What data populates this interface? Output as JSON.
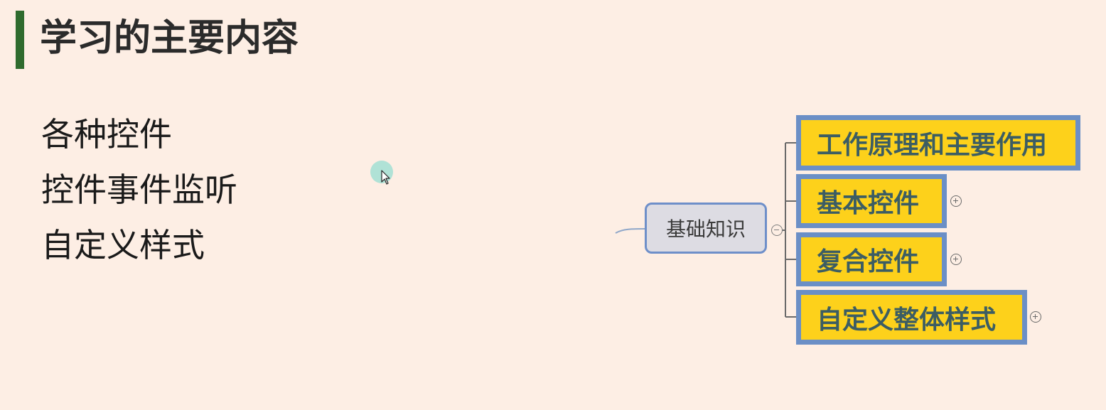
{
  "slide": {
    "title": "学习的主要内容",
    "bullets": [
      "各种控件",
      "控件事件监听",
      "自定义样式"
    ]
  },
  "mindmap": {
    "root": {
      "label": "基础知识",
      "toggle_icon": "collapse-minus-icon"
    },
    "children": [
      {
        "label": "工作原理和主要作用",
        "expandable": false
      },
      {
        "label": "基本控件",
        "expandable": true
      },
      {
        "label": "复合控件",
        "expandable": true
      },
      {
        "label": "自定义整体样式",
        "expandable": true
      }
    ]
  },
  "colors": {
    "background": "#fdeee4",
    "title_accent": "#2f6b2e",
    "node_fill": "#fdd11b",
    "node_border": "#6b8fc6",
    "node_text": "#3c5d63",
    "root_fill": "#dddce3",
    "root_border": "#6e8fc9"
  }
}
